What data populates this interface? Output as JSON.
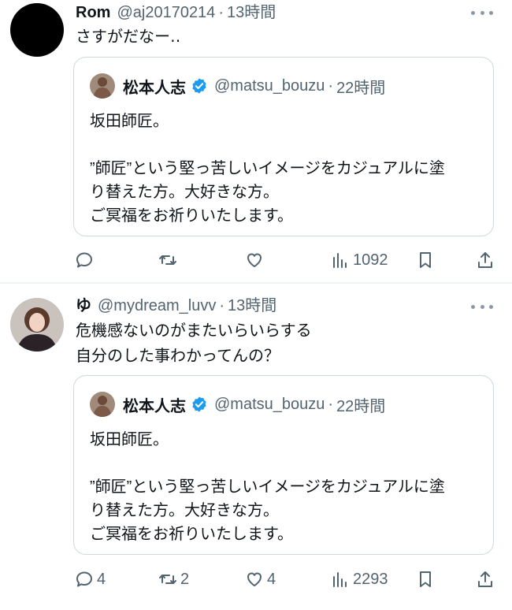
{
  "tweets": [
    {
      "display_name": "Rom",
      "handle": "@aj20170214",
      "separator": "·",
      "time": "13時間",
      "text": "さすがだなー‥",
      "quote": {
        "display_name": "松本人志",
        "handle": "@matsu_bouzu",
        "separator": "·",
        "time": "22時間",
        "text": "坂田師匠。\n\n”師匠”という堅っ苦しいイメージをカジュアルに塗\nり替えた方。大好きな方。\nご冥福をお祈りいたします。"
      },
      "actions": {
        "replies": "",
        "retweets": "",
        "likes": "",
        "views": "1092"
      }
    },
    {
      "display_name": "ゆ",
      "handle": "@mydream_luvv",
      "separator": "·",
      "time": "13時間",
      "text": "危機感ないのがまたいらいらする\n自分のした事わかってんの？",
      "quote": {
        "display_name": "松本人志",
        "handle": "@matsu_bouzu",
        "separator": "·",
        "time": "22時間",
        "text": "坂田師匠。\n\n”師匠”という堅っ苦しいイメージをカジュアルに塗\nり替えた方。大好きな方。\nご冥福をお祈りいたします。"
      },
      "actions": {
        "replies": "4",
        "retweets": "2",
        "likes": "4",
        "views": "2293"
      }
    }
  ],
  "icons": {
    "more": "more-dots-icon",
    "verified": "verified-badge-icon",
    "reply": "reply-icon",
    "retweet": "retweet-icon",
    "like": "like-icon",
    "views": "views-icon",
    "bookmark": "bookmark-icon",
    "share": "share-icon"
  },
  "colors": {
    "text_primary": "#0f1419",
    "text_secondary": "#536471",
    "border": "#cfd9de",
    "verified": "#1d9bf0"
  }
}
